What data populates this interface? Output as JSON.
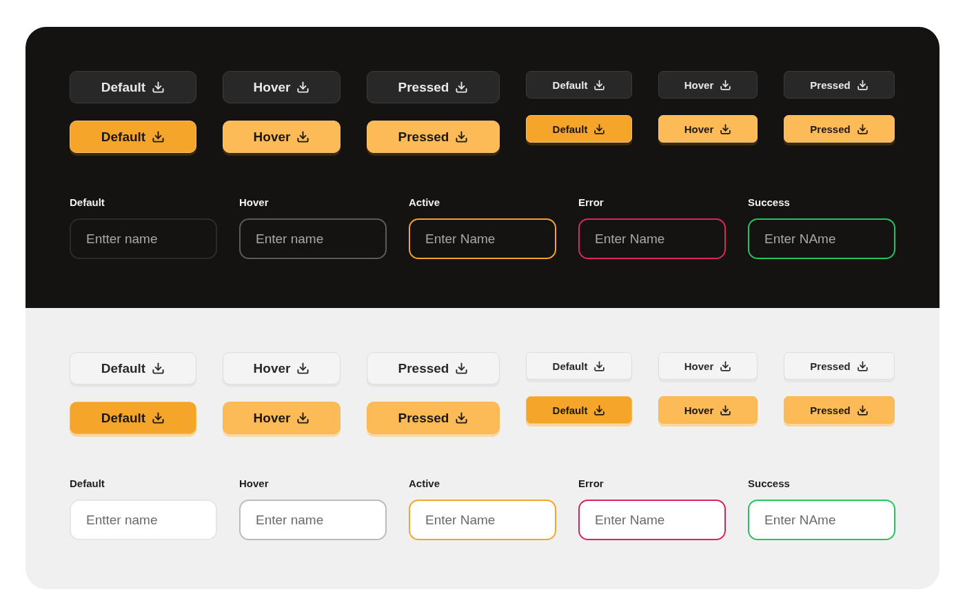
{
  "panels": [
    {
      "dark": true,
      "button_columns": [
        {
          "kind": "large",
          "buttons": [
            {
              "kind": "secondary",
              "label": "Default"
            },
            {
              "kind": "primary",
              "lighter": false,
              "label": "Default"
            }
          ]
        },
        {
          "kind": "large",
          "buttons": [
            {
              "kind": "secondary",
              "label": "Hover"
            },
            {
              "kind": "primary",
              "lighter": true,
              "label": "Hover"
            }
          ]
        },
        {
          "kind": "large",
          "buttons": [
            {
              "kind": "secondary",
              "label": "Pressed"
            },
            {
              "kind": "primary",
              "lighter": true,
              "label": "Pressed"
            }
          ]
        },
        {
          "kind": "small",
          "buttons": [
            {
              "kind": "secondary",
              "label": "Default"
            },
            {
              "kind": "primary",
              "lighter": false,
              "label": "Default"
            }
          ]
        },
        {
          "kind": "small",
          "buttons": [
            {
              "kind": "secondary",
              "label": "Hover"
            },
            {
              "kind": "primary",
              "lighter": true,
              "label": "Hover"
            }
          ]
        },
        {
          "kind": "small",
          "buttons": [
            {
              "kind": "secondary",
              "label": "Pressed"
            },
            {
              "kind": "primary",
              "lighter": true,
              "label": "Pressed"
            }
          ]
        }
      ],
      "fields": [
        {
          "label": "Default",
          "kind": "default",
          "placeholder": "Entter name"
        },
        {
          "label": "Hover",
          "kind": "hover",
          "placeholder": "Enter name"
        },
        {
          "label": "Active",
          "kind": "active",
          "placeholder": "Enter Name"
        },
        {
          "label": "Error",
          "kind": "error",
          "placeholder": "Enter Name"
        },
        {
          "label": "Success",
          "kind": "success",
          "placeholder": "Enter NAme"
        }
      ]
    },
    {
      "dark": false,
      "button_columns": [
        {
          "kind": "large",
          "buttons": [
            {
              "kind": "secondary",
              "label": "Default"
            },
            {
              "kind": "primary",
              "lighter": false,
              "label": "Default"
            }
          ]
        },
        {
          "kind": "large",
          "buttons": [
            {
              "kind": "secondary",
              "label": "Hover"
            },
            {
              "kind": "primary",
              "lighter": true,
              "label": "Hover"
            }
          ]
        },
        {
          "kind": "large",
          "buttons": [
            {
              "kind": "secondary",
              "label": "Pressed"
            },
            {
              "kind": "primary",
              "lighter": true,
              "label": "Pressed"
            }
          ]
        },
        {
          "kind": "small",
          "buttons": [
            {
              "kind": "secondary",
              "label": "Default"
            },
            {
              "kind": "primary",
              "lighter": false,
              "label": "Default"
            }
          ]
        },
        {
          "kind": "small",
          "buttons": [
            {
              "kind": "secondary",
              "label": "Hover"
            },
            {
              "kind": "primary",
              "lighter": true,
              "label": "Hover"
            }
          ]
        },
        {
          "kind": "small",
          "buttons": [
            {
              "kind": "secondary",
              "label": "Pressed"
            },
            {
              "kind": "primary",
              "lighter": true,
              "label": "Pressed"
            }
          ]
        }
      ],
      "fields": [
        {
          "label": "Default",
          "kind": "default",
          "placeholder": "Entter name"
        },
        {
          "label": "Hover",
          "kind": "hover",
          "placeholder": "Enter name"
        },
        {
          "label": "Active",
          "kind": "active",
          "placeholder": "Enter Name"
        },
        {
          "label": "Error",
          "kind": "error",
          "placeholder": "Enter Name"
        },
        {
          "label": "Success",
          "kind": "success",
          "placeholder": "Enter NAme"
        }
      ]
    }
  ]
}
